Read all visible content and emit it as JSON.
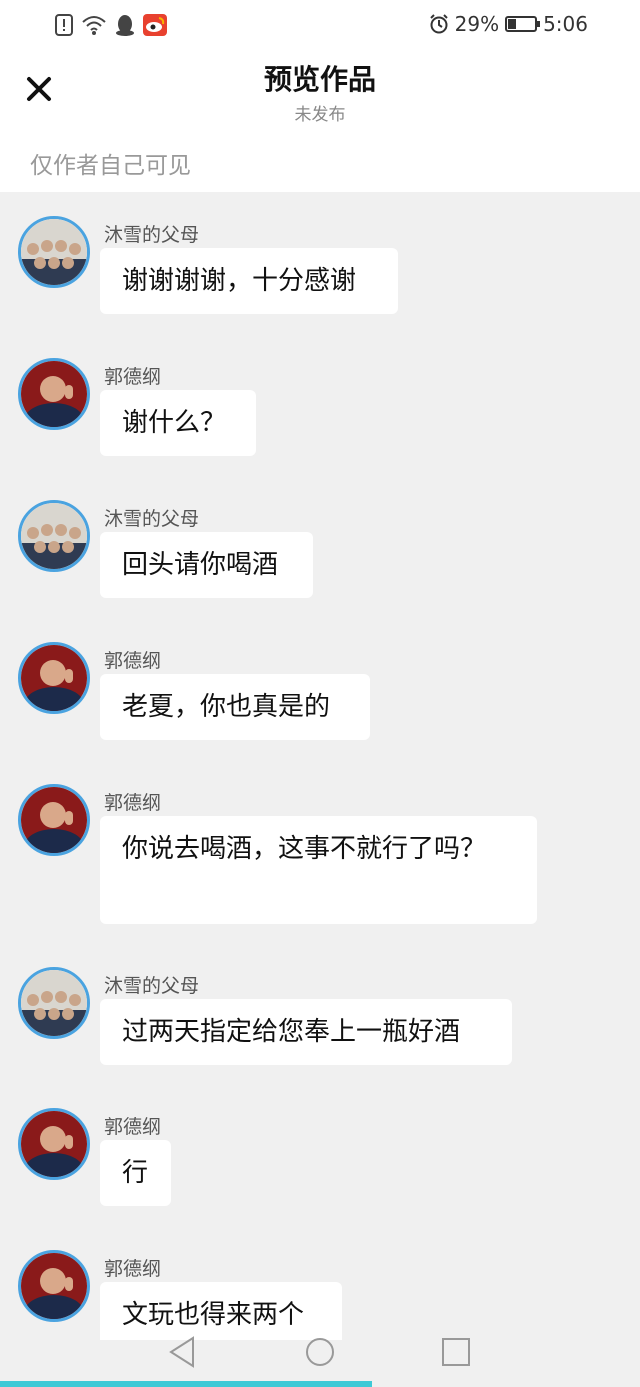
{
  "status_bar": {
    "battery_percent": "29%",
    "time": "5:06",
    "battery_level": 0.29,
    "icons": [
      "alert-icon",
      "wifi-icon",
      "qq-icon",
      "weibo-icon",
      "alarm-icon",
      "battery-icon"
    ]
  },
  "header": {
    "title": "预览作品",
    "subtitle": "未发布",
    "visibility_note": "仅作者自己可见"
  },
  "messages": [
    {
      "sender": "沐雪的父母",
      "text": "谢谢谢谢，十分感谢"
    },
    {
      "sender": "郭德纲",
      "text": "谢什么？"
    },
    {
      "sender": "沐雪的父母",
      "text": "回头请你喝酒"
    },
    {
      "sender": "郭德纲",
      "text": "老夏，你也真是的"
    },
    {
      "sender": "郭德纲",
      "text": "你说去喝酒，这事不就行了吗？"
    },
    {
      "sender": "沐雪的父母",
      "text": "过两天指定给您奉上一瓶好酒"
    },
    {
      "sender": "郭德纲",
      "text": "行"
    },
    {
      "sender": "郭德纲",
      "text": "文玩也得来两个"
    }
  ],
  "nav": {
    "icons": [
      "back-icon",
      "home-icon",
      "recents-icon"
    ]
  },
  "colors": {
    "accent": "#3ec9d6",
    "avatar_ring": "#4aa3e0",
    "background": "#f0f0f0"
  }
}
